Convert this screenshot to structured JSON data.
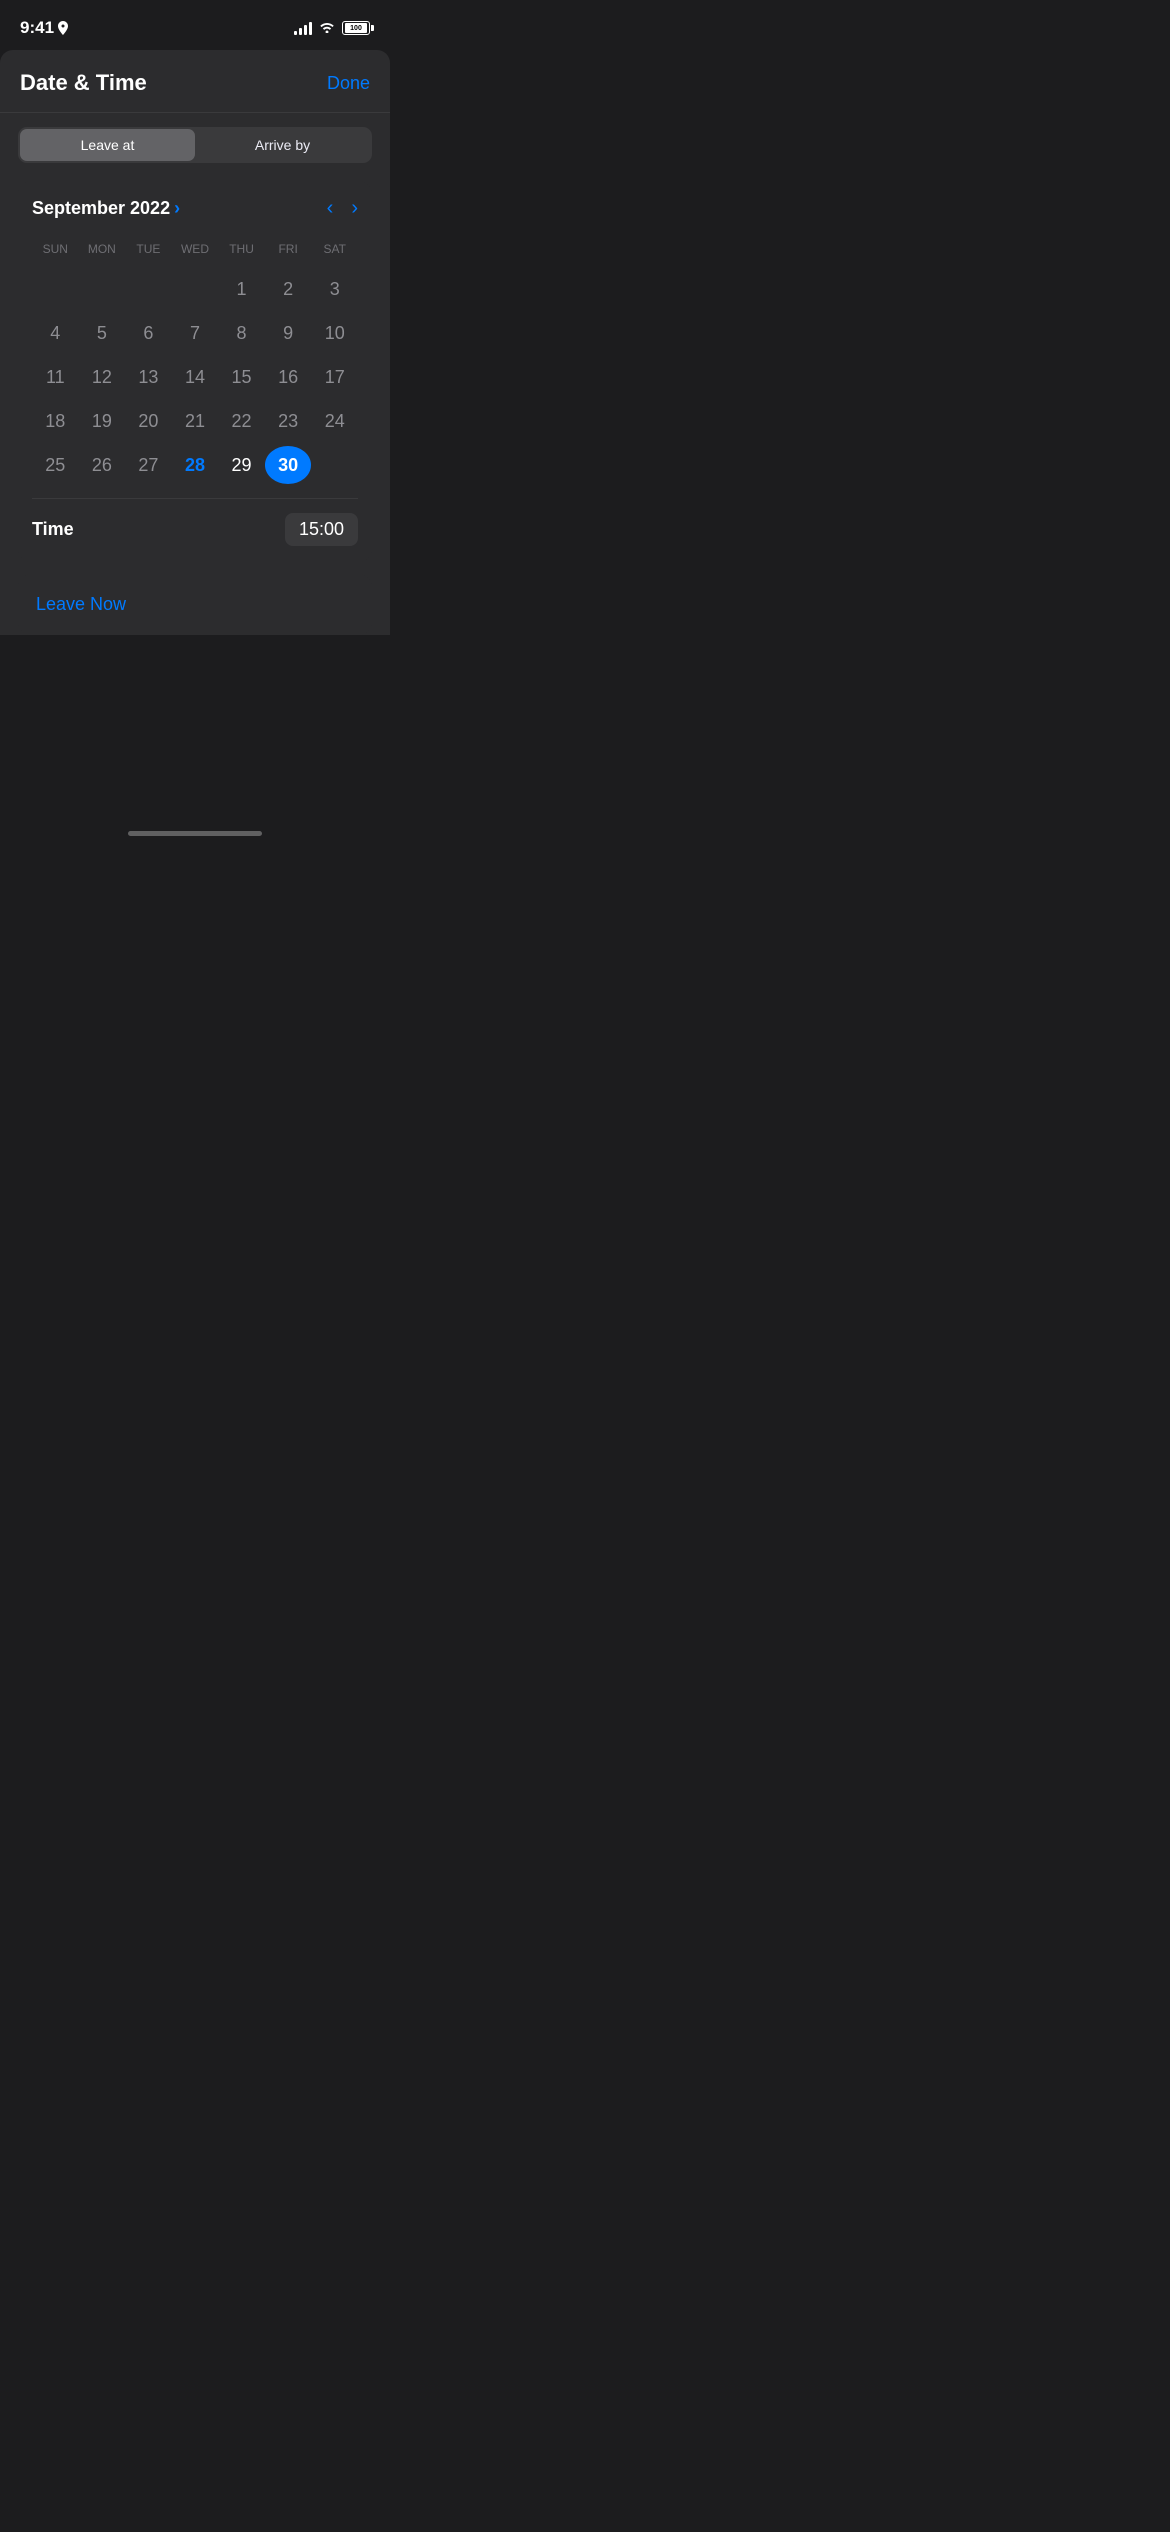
{
  "statusBar": {
    "time": "9:41",
    "battery": "100"
  },
  "header": {
    "title": "Date & Time",
    "done": "Done"
  },
  "segment": {
    "leaveAt": "Leave at",
    "arriveBy": "Arrive by",
    "activeIndex": 0
  },
  "calendar": {
    "monthLabel": "September 2022",
    "daysOfWeek": [
      "SUN",
      "MON",
      "TUE",
      "WED",
      "THU",
      "FRI",
      "SAT"
    ],
    "startOffset": 4,
    "daysInMonth": 30,
    "selectedDay": 30,
    "highlightedDay": 28,
    "todayDay": 29
  },
  "time": {
    "label": "Time",
    "value": "15:00"
  },
  "leaveNow": {
    "label": "Leave Now"
  }
}
